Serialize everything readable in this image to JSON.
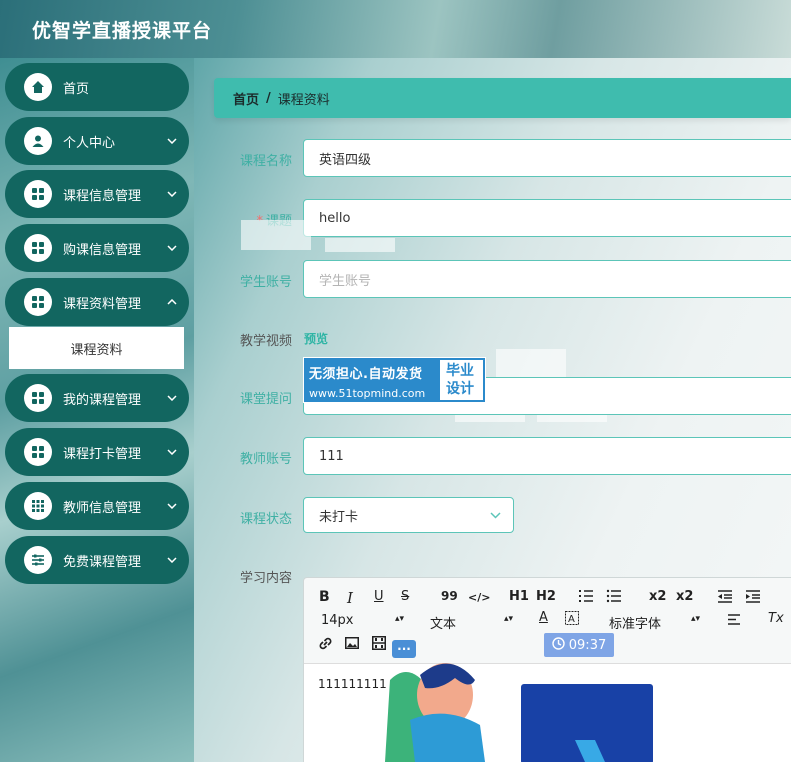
{
  "app": {
    "title": "优智学直播授课平台"
  },
  "sidebar": {
    "items": [
      {
        "label": "首页",
        "icon": "home-icon"
      },
      {
        "label": "个人中心",
        "icon": "user-icon"
      },
      {
        "label": "课程信息管理",
        "icon": "grid-icon"
      },
      {
        "label": "购课信息管理",
        "icon": "grid-icon"
      },
      {
        "label": "课程资料管理",
        "icon": "grid-icon"
      },
      {
        "label": "我的课程管理",
        "icon": "grid-icon"
      },
      {
        "label": "课程打卡管理",
        "icon": "grid-icon"
      },
      {
        "label": "教师信息管理",
        "icon": "dots-grid-icon"
      },
      {
        "label": "免费课程管理",
        "icon": "sliders-icon"
      }
    ],
    "sub_item": "课程资料"
  },
  "breadcrumb": {
    "home": "首页",
    "sep": "/",
    "current": "课程资料"
  },
  "form": {
    "course_name_label": "课程名称",
    "course_name_value": "英语四级",
    "topic_required": "*",
    "topic_label": "课题",
    "topic_value": "hello",
    "student_label": "学生账号",
    "student_placeholder": "学生账号",
    "video_label": "教学视频",
    "video_preview": "预览",
    "question_label": "课堂提问",
    "teacher_label": "教师账号",
    "teacher_value": "111",
    "status_label": "课程状态",
    "status_value": "未打卡",
    "content_label": "学习内容"
  },
  "watermark": {
    "line1": "无须担心.自动发货",
    "line2": "www.51topmind.com",
    "right1": "毕业",
    "right2": "设计"
  },
  "editor": {
    "font_size": "14px",
    "text_type": "文本",
    "font_family": "标准字体",
    "timer": "09:37",
    "more": "···",
    "content": "111111111",
    "buttons": {
      "bold": "B",
      "italic": "I",
      "underline": "U",
      "strike": "S",
      "quote": "99",
      "code": "</>",
      "h1": "H1",
      "h2": "H2",
      "sub": "x2",
      "sup": "x2",
      "color": "A",
      "clear": "Tx"
    }
  },
  "colors": {
    "accent": "#3fbcae",
    "sidebar_item": "#126660",
    "label": "#3fb0a4"
  }
}
